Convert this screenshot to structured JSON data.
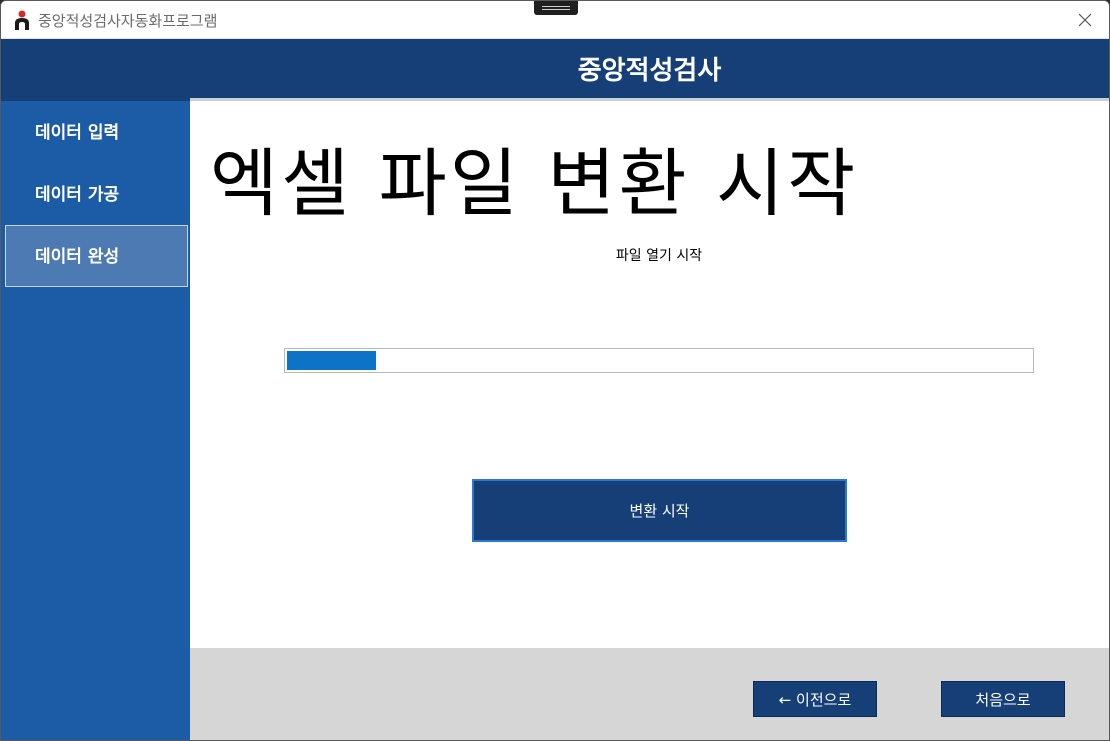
{
  "window": {
    "title": "중앙적성검사자동화프로그램"
  },
  "header": {
    "title": "중앙적성검사"
  },
  "sidebar": {
    "items": [
      {
        "label": "데이터 입력",
        "active": false
      },
      {
        "label": "데이터 가공",
        "active": false
      },
      {
        "label": "데이터 완성",
        "active": true
      }
    ]
  },
  "main": {
    "heading": "엑셀 파일 변환 시작",
    "status": "파일 열기 시작",
    "progress": 0.12,
    "convert_button": "변환 시작"
  },
  "footer": {
    "prev_button": "← 이전으로",
    "home_button": "처음으로"
  },
  "colors": {
    "header": "#163f78",
    "sidebar": "#1c5ca7",
    "active_item": "#4d7ab2",
    "progress_fill": "#0c73c7",
    "footer": "#d6d6d6"
  }
}
